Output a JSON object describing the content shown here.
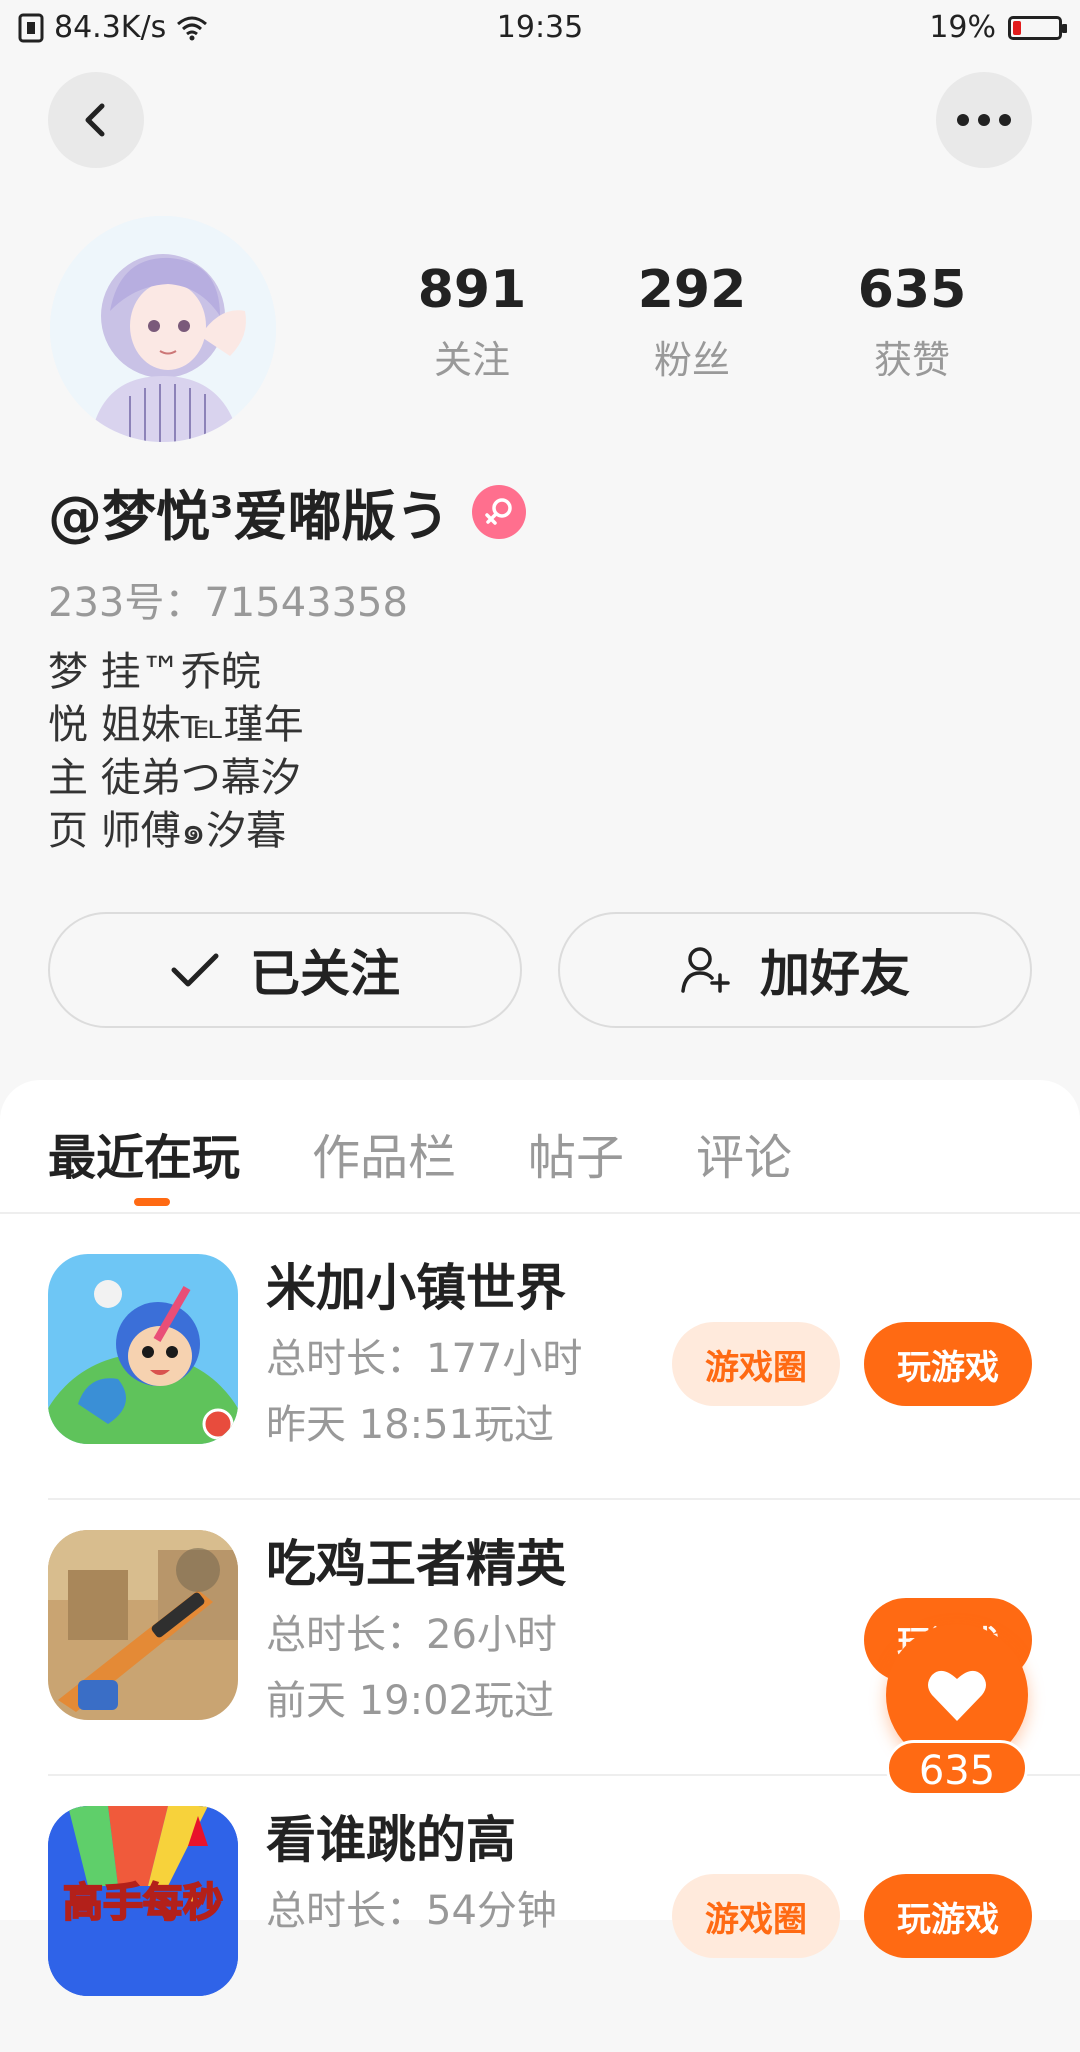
{
  "status_bar": {
    "net_speed": "84.3K/s",
    "time": "19:35",
    "battery": "19%",
    "battery_level": 0.19
  },
  "profile": {
    "stats": [
      {
        "value": "891",
        "label": "关注"
      },
      {
        "value": "292",
        "label": "粉丝"
      },
      {
        "value": "635",
        "label": "获赞"
      }
    ],
    "username": "@梦悦³爱嘟版う",
    "user_id": "233号：71543358",
    "bio": [
      "梦 挂™乔皖",
      "悦 姐妹℡瑾年",
      "主 徒弟つ幕汐",
      "页 师傅๑汐暮"
    ],
    "followed_label": "已关注",
    "add_friend_label": "加好友"
  },
  "tabs": [
    "最近在玩",
    "作品栏",
    "帖子",
    "评论"
  ],
  "active_tab": 0,
  "games": [
    {
      "title": "米加小镇世界",
      "duration": "总时长：177小时",
      "last_played": "昨天 18:51玩过",
      "circle_label": "游戏圈",
      "play_label": "玩游戏"
    },
    {
      "title": "吃鸡王者精英",
      "duration": "总时长：26小时",
      "last_played": "前天 19:02玩过",
      "circle_label": "",
      "play_label": "玩游戏"
    },
    {
      "title": "看谁跳的高",
      "duration": "总时长：54分钟",
      "last_played": "",
      "circle_label": "游戏圈",
      "play_label": "玩游戏",
      "icon_text": "高手每秒"
    }
  ],
  "like_count": "635",
  "colors": {
    "accent": "#ff6a13",
    "accent_light": "#ffeadc",
    "gender_female": "#ff6f8e",
    "muted_text": "#999999"
  }
}
